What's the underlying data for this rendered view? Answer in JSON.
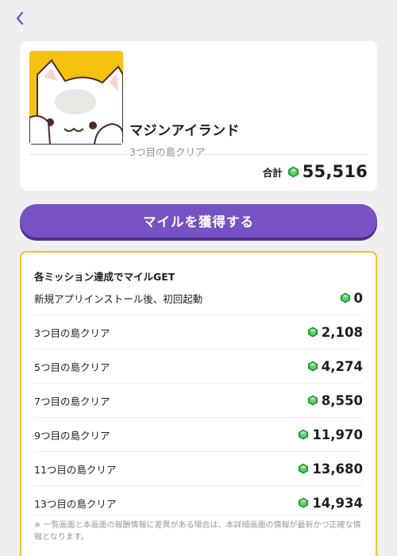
{
  "colors": {
    "background": "#efeff1",
    "accent_purple": "#7752c2",
    "mission_border": "#f2c21e",
    "gem_green": "#3dbb4a",
    "app_icon_bg": "#f4c10f"
  },
  "nav": {
    "back_icon": "chevron-left-icon"
  },
  "app": {
    "name": "マジンアイランド",
    "subtitle": "3つ目の島クリア",
    "icon": "white-cat-mascot"
  },
  "total": {
    "label": "合計",
    "value": "55,516",
    "icon": "green-gem-icon"
  },
  "cta": {
    "label": "マイルを獲得する"
  },
  "missions": {
    "title": "各ミッション達成でマイルGET",
    "items": [
      {
        "label": "新規アプリインストール後、初回起動",
        "value": "0"
      },
      {
        "label": "3つ目の島クリア",
        "value": "2,108"
      },
      {
        "label": "5つ目の島クリア",
        "value": "4,274"
      },
      {
        "label": "7つ目の島クリア",
        "value": "8,550"
      },
      {
        "label": "9つ目の島クリア",
        "value": "11,970"
      },
      {
        "label": "11つ目の島クリア",
        "value": "13,680"
      },
      {
        "label": "13つ目の島クリア",
        "value": "14,934"
      }
    ],
    "note": "※ 一覧画面と本画面の報酬情報に差異がある場合は、本詳細画面の情報が最新かつ正確な情報となります。"
  }
}
